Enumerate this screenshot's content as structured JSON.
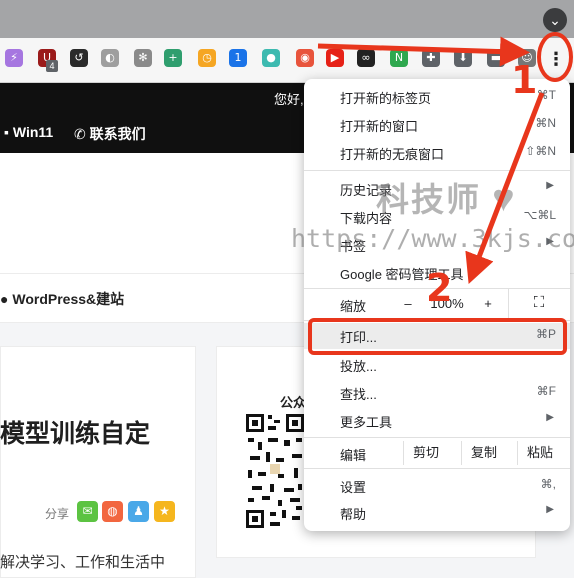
{
  "browser": {
    "chevron_icon": "chevron-down-icon",
    "extension_badge": "4",
    "extensions": [
      {
        "icon": "lightning-ext-icon",
        "glyph": "⚡",
        "color": "#a676e0"
      },
      {
        "icon": "ublock-ext-icon",
        "glyph": "U",
        "color": "#9b1b1b"
      },
      {
        "icon": "swoosh-ext-icon",
        "glyph": "↺",
        "color": "#2b2b2b"
      },
      {
        "icon": "leaf-ext-icon",
        "glyph": "◐",
        "color": "#9e9e9e"
      },
      {
        "icon": "gear-ext-icon",
        "glyph": "✻",
        "color": "#8a8a8a"
      },
      {
        "icon": "plus-ext-icon",
        "glyph": "+",
        "color": "#2f9e6e"
      },
      {
        "icon": "clock-ext-icon",
        "glyph": "◷",
        "color": "#f5a623"
      },
      {
        "icon": "onepassword-ext-icon",
        "glyph": "1",
        "color": "#1a73e8"
      },
      {
        "icon": "cat-ext-icon",
        "glyph": "●",
        "color": "#3dbab0"
      },
      {
        "icon": "record-ext-icon",
        "glyph": "◉",
        "color": "#e8543c"
      },
      {
        "icon": "youtube-ext-icon",
        "glyph": "▶",
        "color": "#e62117"
      },
      {
        "icon": "glasses-ext-icon",
        "glyph": "∞",
        "color": "#222222"
      },
      {
        "icon": "n-ext-icon",
        "glyph": "N",
        "color": "#2fa84f"
      },
      {
        "icon": "puzzle-ext-icon",
        "glyph": "✚",
        "color": "#5f6368"
      },
      {
        "icon": "download-ext-icon",
        "glyph": "⬇",
        "color": "#5f6368"
      },
      {
        "icon": "folder-ext-icon",
        "glyph": "▬",
        "color": "#5f6368"
      },
      {
        "icon": "profile-ext-icon",
        "glyph": "☺",
        "color": "#777777"
      }
    ],
    "menu_icon": "kebab-menu-icon"
  },
  "page": {
    "greeting": "您好,",
    "nav": [
      "Win11",
      "联系我们"
    ],
    "breadcrumb": "WordPress&建站",
    "card_title": "模型训练自定",
    "share_label": "分享",
    "share_buttons": [
      {
        "icon": "wechat-icon",
        "glyph": "✉",
        "color": "#5cc342"
      },
      {
        "icon": "weibo-icon",
        "glyph": "◍",
        "color": "#f2663f"
      },
      {
        "icon": "qq-icon",
        "glyph": "♟",
        "color": "#4aa8e8"
      },
      {
        "icon": "qzone-icon",
        "glyph": "★",
        "color": "#f5b61e"
      }
    ],
    "card_snippet": "解决学习、工作和生活中",
    "qr_label": "公众"
  },
  "menu": {
    "items": [
      {
        "label": "打开新的标签页",
        "shortcut": "⌘T"
      },
      {
        "label": "打开新的窗口",
        "shortcut": "⌘N"
      },
      {
        "label": "打开新的无痕窗口",
        "shortcut": "⇧⌘N"
      },
      {
        "label": "历史记录",
        "shortcut": ""
      },
      {
        "label": "下载内容",
        "shortcut": "⌥⌘L"
      },
      {
        "label": "书签",
        "shortcut": ""
      },
      {
        "label": "Google 密码管理工具",
        "shortcut": ""
      }
    ],
    "zoom": {
      "label": "缩放",
      "minus": "–",
      "value": "100%",
      "plus": "+",
      "fullscreen_icon": "fullscreen-icon"
    },
    "print": {
      "label": "打印...",
      "shortcut": "⌘P"
    },
    "cast": {
      "label": "投放..."
    },
    "find": {
      "label": "查找...",
      "shortcut": "⌘F"
    },
    "more_tools": {
      "label": "更多工具"
    },
    "edit": {
      "label": "编辑",
      "cut": "剪切",
      "copy": "复制",
      "paste": "粘贴"
    },
    "settings": {
      "label": "设置",
      "shortcut": "⌘,"
    },
    "help": {
      "label": "帮助"
    }
  },
  "watermark": {
    "title": "科技师",
    "url": "https://www.3kjs.com"
  },
  "annotations": {
    "step1": "1",
    "step2": "2",
    "color": "#e8361c"
  }
}
